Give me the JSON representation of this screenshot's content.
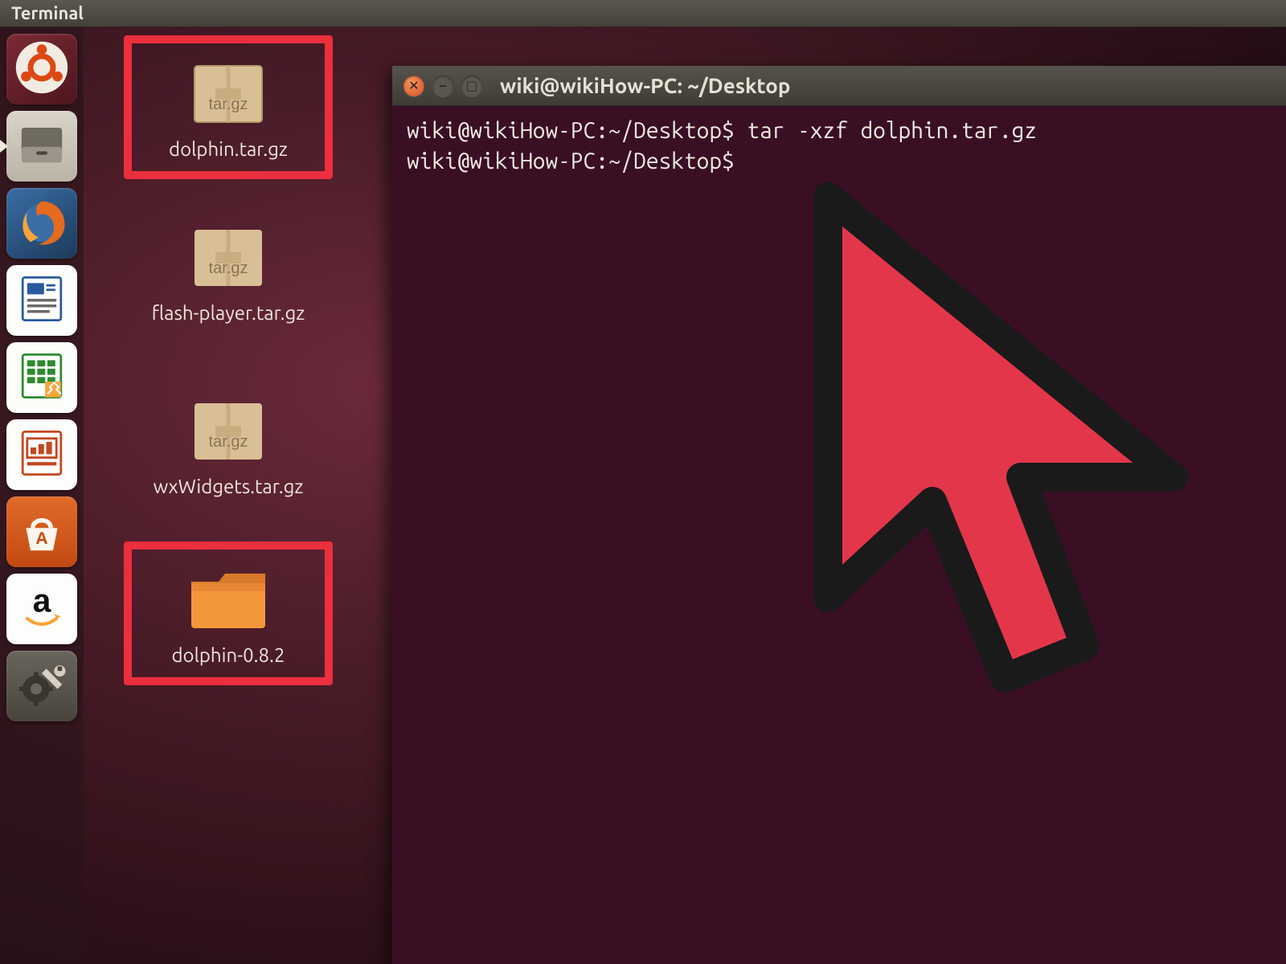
{
  "topbar": {
    "title": "Terminal"
  },
  "launcher": {
    "items": [
      {
        "name": "dash"
      },
      {
        "name": "files"
      },
      {
        "name": "firefox"
      },
      {
        "name": "writer"
      },
      {
        "name": "calc"
      },
      {
        "name": "impress"
      },
      {
        "name": "software-center"
      },
      {
        "name": "amazon"
      },
      {
        "name": "settings"
      }
    ]
  },
  "desktop": {
    "icons": [
      {
        "label": "dolphin.tar.gz",
        "type": "targz",
        "highlighted": true
      },
      {
        "label": "flash-player.tar.gz",
        "type": "targz",
        "highlighted": false
      },
      {
        "label": "wxWidgets.tar.gz",
        "type": "targz",
        "highlighted": false
      },
      {
        "label": "dolphin-0.8.2",
        "type": "folder",
        "highlighted": true
      }
    ]
  },
  "terminal": {
    "title": "wiki@wikiHow-PC: ~/Desktop",
    "lines": [
      "wiki@wikiHow-PC:~/Desktop$ tar -xzf dolphin.tar.gz",
      "wiki@wikiHow-PC:~/Desktop$"
    ]
  },
  "box_label": "tar.gz"
}
